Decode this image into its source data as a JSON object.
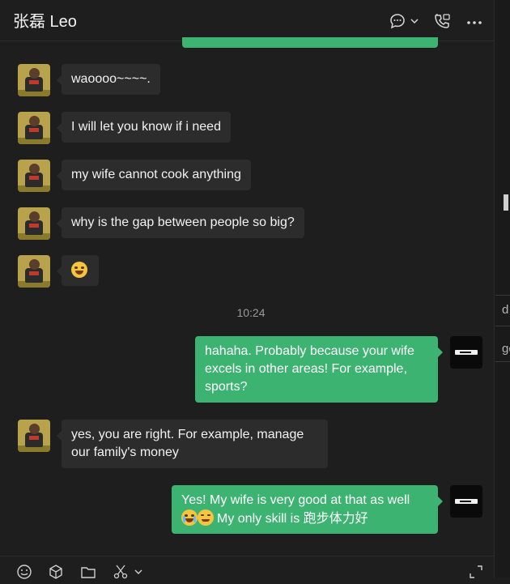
{
  "header": {
    "title": "张磊 Leo",
    "icons": [
      "chat-bubble-icon",
      "chevron-down-icon",
      "video-call-icon",
      "more-icon"
    ]
  },
  "messages": [
    {
      "from": "friend",
      "text": "waoooo~~~~."
    },
    {
      "from": "friend",
      "text": "I will let you know if i need"
    },
    {
      "from": "friend",
      "text": "my wife cannot cook anything"
    },
    {
      "from": "friend",
      "text": "why is the gap between people so big?"
    },
    {
      "from": "friend",
      "text": "",
      "emoji": "grinning-sweat-emoji"
    },
    {
      "from": "self",
      "lines": [
        "hahaha. Probably because your wife",
        "excels in other areas! For example,",
        "sports?"
      ]
    },
    {
      "from": "friend",
      "lines": [
        "yes, you are right. For example, manage",
        "our family's money"
      ]
    },
    {
      "from": "self",
      "lines": [
        "Yes! My wife is very good at that as well",
        "My only skill is 跑步体力好"
      ],
      "emoji": [
        "crying-emoji",
        "relieved-emoji"
      ]
    }
  ],
  "timestamp": "10:24",
  "toolbar": {
    "icons": [
      "emoji-icon",
      "box-icon",
      "folder-icon",
      "scissors-icon",
      "chevron-down-icon",
      "expand-icon"
    ]
  },
  "side_panel": {
    "fragments": [
      "d",
      "ge"
    ]
  },
  "colors": {
    "background": "#1e1e1e",
    "self_bubble": "#3cb371",
    "friend_bubble": "#2c2c2c"
  }
}
